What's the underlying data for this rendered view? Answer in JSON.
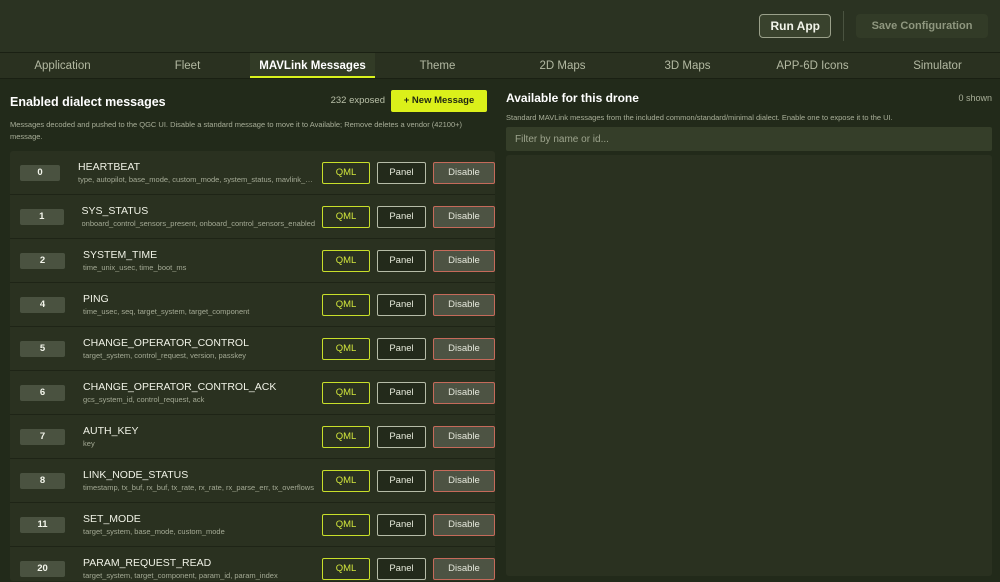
{
  "header": {
    "run_label": "Run App",
    "save_label": "Save Configuration"
  },
  "tabs": [
    {
      "label": "Application"
    },
    {
      "label": "Fleet"
    },
    {
      "label": "MAVLink Messages"
    },
    {
      "label": "Theme"
    },
    {
      "label": "2D Maps"
    },
    {
      "label": "3D Maps"
    },
    {
      "label": "APP-6D Icons"
    },
    {
      "label": "Simulator"
    }
  ],
  "active_tab": "MAVLink Messages",
  "enabled": {
    "title": "Enabled dialect messages",
    "count": "232 exposed",
    "new_label": "+ New Message",
    "description": "Messages decoded and pushed to the QGC UI. Disable a standard message to move it to Available; Remove deletes a vendor (42100+) message.",
    "qml_label": "QML",
    "panel_label": "Panel",
    "disable_label": "Disable",
    "messages": [
      {
        "id": "0",
        "name": "HEARTBEAT",
        "fields": "type, autopilot, base_mode, custom_mode, system_status, mavlink_version"
      },
      {
        "id": "1",
        "name": "SYS_STATUS",
        "fields": "onboard_control_sensors_present, onboard_control_sensors_enabled"
      },
      {
        "id": "2",
        "name": "SYSTEM_TIME",
        "fields": "time_unix_usec, time_boot_ms"
      },
      {
        "id": "4",
        "name": "PING",
        "fields": "time_usec, seq, target_system, target_component"
      },
      {
        "id": "5",
        "name": "CHANGE_OPERATOR_CONTROL",
        "fields": "target_system, control_request, version, passkey"
      },
      {
        "id": "6",
        "name": "CHANGE_OPERATOR_CONTROL_ACK",
        "fields": "gcs_system_id, control_request, ack"
      },
      {
        "id": "7",
        "name": "AUTH_KEY",
        "fields": "key"
      },
      {
        "id": "8",
        "name": "LINK_NODE_STATUS",
        "fields": "timestamp, tx_buf, rx_buf, tx_rate, rx_rate, rx_parse_err, tx_overflows"
      },
      {
        "id": "11",
        "name": "SET_MODE",
        "fields": "target_system, base_mode, custom_mode"
      },
      {
        "id": "20",
        "name": "PARAM_REQUEST_READ",
        "fields": "target_system, target_component, param_id, param_index"
      }
    ]
  },
  "available": {
    "title": "Available for this drone",
    "count": "0 shown",
    "description": "Standard MAVLink messages from the included common/standard/minimal dialect. Enable one to expose it to the UI.",
    "filter_placeholder": "Filter by name or id..."
  },
  "colors": {
    "accent": "#dbf01a",
    "background": "#222a1a",
    "panel": "#2a3120",
    "danger_border": "#c56a5a"
  }
}
